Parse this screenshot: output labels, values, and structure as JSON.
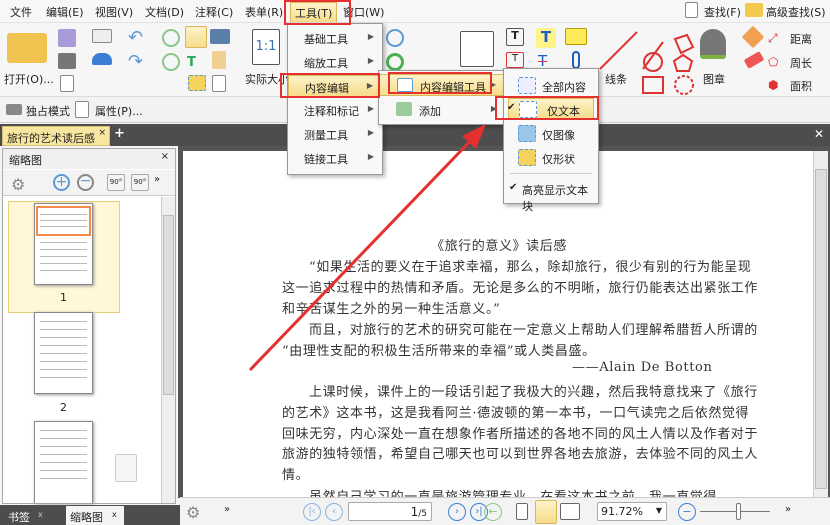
{
  "menubar": {
    "items": [
      "文件",
      "编辑(E)",
      "视图(V)",
      "文档(D)",
      "注释(C)",
      "表单(R)",
      "工具(T)",
      "窗口(W)"
    ],
    "find": "查找(F)",
    "advanced_find": "高级查找(S)"
  },
  "ribbon": {
    "open": "打开(O)...",
    "actual_size": "实际大小",
    "actual_size_icon": "1:1",
    "lines": "线条",
    "stamp": "图章",
    "distance": "距离",
    "perimeter": "周长",
    "area": "面积"
  },
  "toolbar2": {
    "exclusive_mode": "独占模式",
    "properties": "属性(P)..."
  },
  "tabs": {
    "document": "旅行的艺术读后感",
    "close": "×",
    "add": "+"
  },
  "left_panel": {
    "title": "缩略图",
    "close": "×",
    "pages": [
      "1",
      "2"
    ],
    "bottom_tabs": [
      "书签",
      "缩略图"
    ]
  },
  "tools_menu": {
    "items": [
      "基础工具",
      "缩放工具",
      "内容编辑",
      "注释和标记",
      "测量工具",
      "链接工具"
    ]
  },
  "content_edit_menu": {
    "items": [
      "内容编辑工具",
      "添加"
    ]
  },
  "content_edit_tool_menu": {
    "items": [
      "全部内容",
      "仅文本",
      "仅图像",
      "仅形状"
    ],
    "checked": "仅文本",
    "highlight_text_blocks": "高亮显示文本块",
    "highlight_checked": true
  },
  "document": {
    "title": "《旅行的意义》读后感",
    "lines": [
      "“如果生活的要义在于追求幸福，那么，除却旅行，很少有别的行为能呈现",
      "这一追求过程中的热情和矛盾。无论是多么的不明晰，旅行仍能表达出紧张工作",
      "和辛苦谋生之外的另一种生活意义。”",
      "而且，对旅行的艺术的研究可能在一定意义上帮助人们理解希腊哲人所谓的",
      "“由理性支配的积极生活所带来的幸福”或人类昌盛。",
      "——Alain De Botton",
      "上课时候，课件上的一段话引起了我极大的兴趣，然后我特意找来了《旅行",
      "的艺术》这本书，这是我看阿兰·德波顿的第一本书，一口气读完之后依然觉得",
      "回味无穷，内心深处一直在想象作者所描述的各地不同的风土人情以及作者对于",
      "旅游的独特领悟，希望自己哪天也可以到世界各地去旅游，去体验不同的风土人",
      "情。",
      "虽然自己学习的一直是旅游管理专业，在看这本书之前，我一直觉得旅游就"
    ]
  },
  "statusbar": {
    "page_current": "1",
    "page_total": "/5",
    "zoom": "91.72%"
  },
  "colors": {
    "annotation_red": "#e53030",
    "highlight": "#f6dc8a"
  }
}
